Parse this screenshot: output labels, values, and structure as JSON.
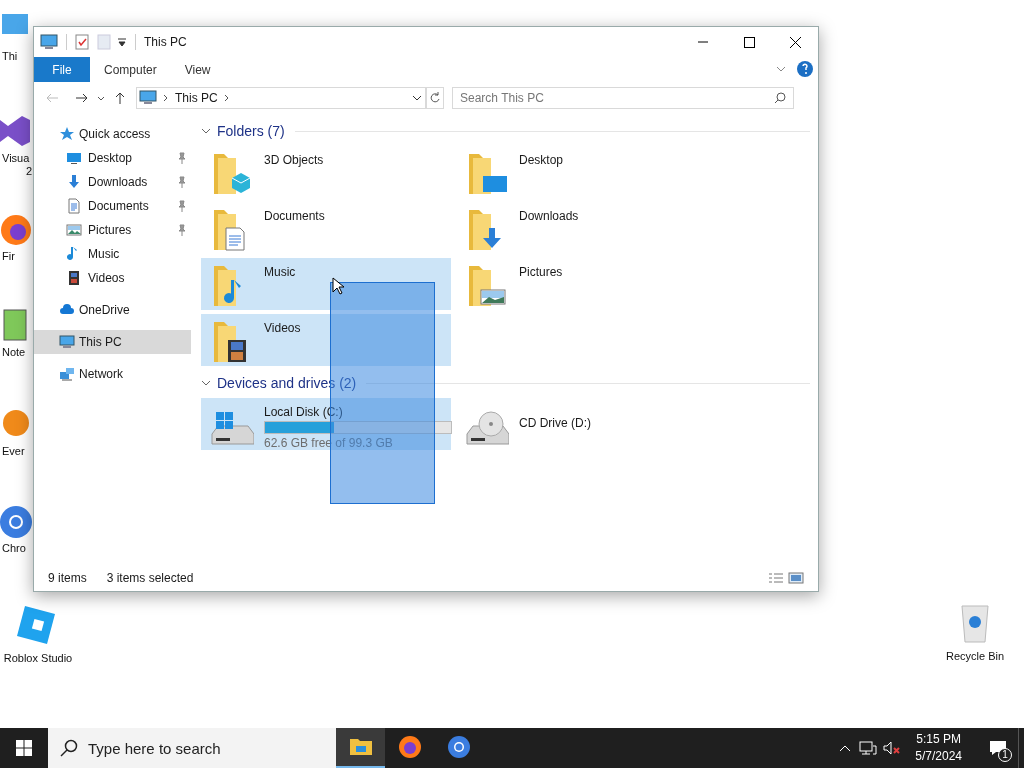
{
  "desktop_icons": [
    {
      "kind": "pc",
      "label": "Thi"
    },
    {
      "kind": "vs",
      "label": "Visua",
      "label2": "2"
    },
    {
      "kind": "firefox",
      "label": "Fir"
    },
    {
      "kind": "notepad",
      "label": "Note"
    },
    {
      "kind": "everything",
      "label": "Ever"
    },
    {
      "kind": "chrome",
      "label": "Chro"
    }
  ],
  "desktop_roblox": {
    "label": "Roblox Studio"
  },
  "desktop_recycle": {
    "label": "Recycle Bin"
  },
  "window": {
    "title": "This PC",
    "ribbon_tabs": [
      {
        "label": "File",
        "selected": true
      },
      {
        "label": "Computer",
        "selected": false
      },
      {
        "label": "View",
        "selected": false
      }
    ],
    "address": "This PC",
    "search_placeholder": "Search This PC",
    "nav": [
      {
        "label": "Quick access",
        "kind": "star",
        "children": [
          {
            "label": "Desktop",
            "kind": "desktop",
            "pinned": true
          },
          {
            "label": "Downloads",
            "kind": "downloads",
            "pinned": true
          },
          {
            "label": "Documents",
            "kind": "documents",
            "pinned": true
          },
          {
            "label": "Pictures",
            "kind": "pictures",
            "pinned": true
          },
          {
            "label": "Music",
            "kind": "music",
            "pinned": false
          },
          {
            "label": "Videos",
            "kind": "videos",
            "pinned": false
          }
        ]
      },
      {
        "label": "OneDrive",
        "kind": "cloud",
        "selected": false
      },
      {
        "label": "This PC",
        "kind": "pc",
        "selected": true
      },
      {
        "label": "Network",
        "kind": "network",
        "selected": false
      }
    ],
    "groups": [
      {
        "title": "Folders (7)",
        "expanded": true,
        "items": [
          {
            "name": "3D Objects",
            "kind": "cube",
            "selected": false
          },
          {
            "name": "Desktop",
            "kind": "desktop",
            "selected": false
          },
          {
            "name": "Documents",
            "kind": "documents",
            "selected": false
          },
          {
            "name": "Downloads",
            "kind": "downloads",
            "selected": false
          },
          {
            "name": "Music",
            "kind": "music",
            "selected": true
          },
          {
            "name": "Pictures",
            "kind": "pictures",
            "selected": false
          },
          {
            "name": "Videos",
            "kind": "videos",
            "selected": true
          }
        ]
      },
      {
        "title": "Devices and drives (2)",
        "expanded": true,
        "items": [
          {
            "name": "Local Disk (C:)",
            "kind": "disk",
            "selected": true,
            "level": 0.37,
            "detail": "62.6 GB free of 99.3 GB"
          },
          {
            "name": "CD Drive (D:)",
            "kind": "cd",
            "selected": false
          }
        ]
      }
    ],
    "status": {
      "count": "9 items",
      "selected": "3 items selected"
    }
  },
  "taskbar": {
    "search_placeholder": "Type here to search",
    "apps": [
      {
        "kind": "explorer",
        "active": true
      },
      {
        "kind": "firefox",
        "active": false
      },
      {
        "kind": "chrome",
        "active": false
      }
    ],
    "time": "5:15 PM",
    "date": "5/7/2024",
    "notifications": "1"
  }
}
